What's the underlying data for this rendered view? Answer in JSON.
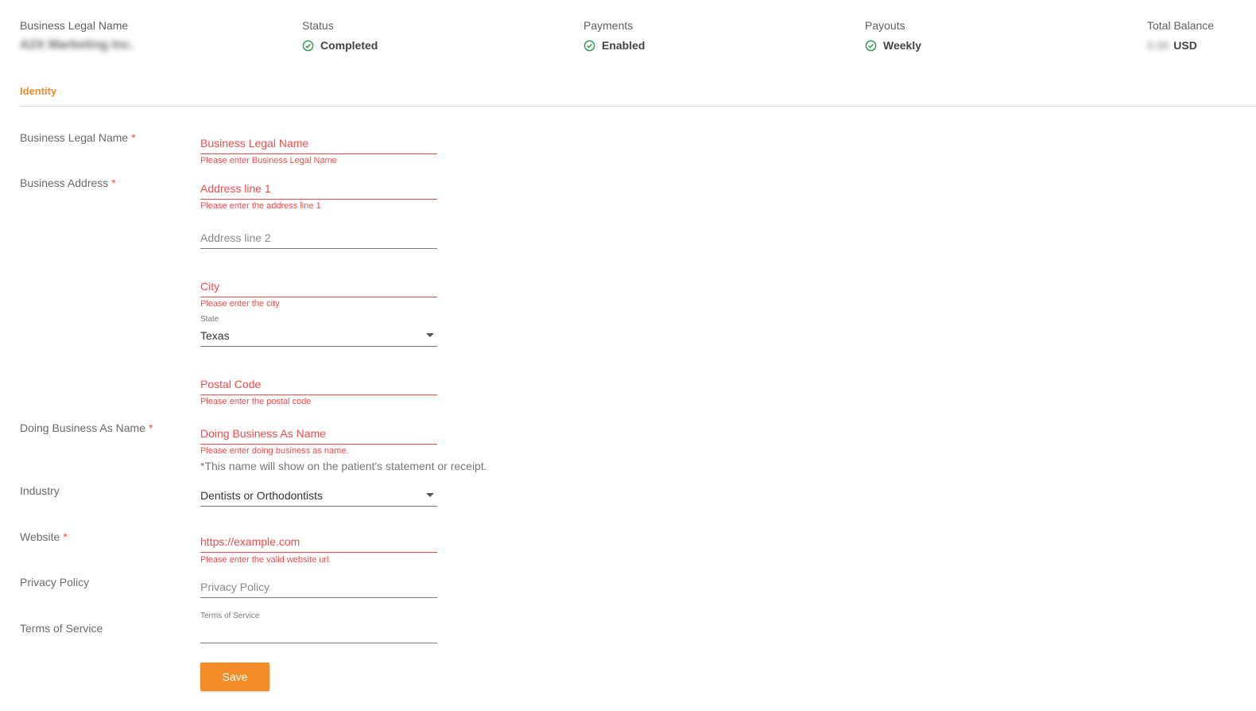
{
  "summary": {
    "legal_name": {
      "label": "Business Legal Name",
      "value": "A2X Marketing Inc."
    },
    "status": {
      "label": "Status",
      "value": "Completed",
      "icon": "check-circle-icon"
    },
    "payments": {
      "label": "Payments",
      "value": "Enabled",
      "icon": "check-circle-icon"
    },
    "payouts": {
      "label": "Payouts",
      "value": "Weekly",
      "icon": "check-circle-icon"
    },
    "balance": {
      "label": "Total Balance",
      "amount": "0.00",
      "currency": "USD"
    }
  },
  "tab": {
    "label": "Identity",
    "color": "#f0892a"
  },
  "form": {
    "legal_name": {
      "label": "Business Legal Name",
      "placeholder": "Business Legal Name",
      "error": "Please enter Business Legal Name"
    },
    "address": {
      "label": "Business Address",
      "line1": {
        "placeholder": "Address line 1",
        "error": "Please enter the address line 1"
      },
      "line2": {
        "placeholder": "Address line 2"
      },
      "city": {
        "placeholder": "City",
        "error": "Please enter the city"
      },
      "state": {
        "label": "State",
        "value": "Texas"
      },
      "postal": {
        "placeholder": "Postal Code",
        "error": "Please enter the postal code"
      }
    },
    "dba": {
      "label": "Doing Business As Name",
      "placeholder": "Doing Business As Name",
      "error": "Please enter doing business as name.",
      "hint": "*This name will show on the patient's statement or receipt."
    },
    "industry": {
      "label": "Industry",
      "value": "Dentists or Orthodontists"
    },
    "website": {
      "label": "Website",
      "placeholder": "https://example.com",
      "error": "Please enter the valid website url."
    },
    "privacy": {
      "label": "Privacy Policy",
      "placeholder": "Privacy Policy"
    },
    "terms": {
      "label": "Terms of Service",
      "float_label": "Terms of Service"
    },
    "required_mark": "*",
    "save_label": "Save"
  },
  "colors": {
    "accent": "#f28c28",
    "error": "#ef4b4b",
    "success": "#2e9e4f"
  }
}
